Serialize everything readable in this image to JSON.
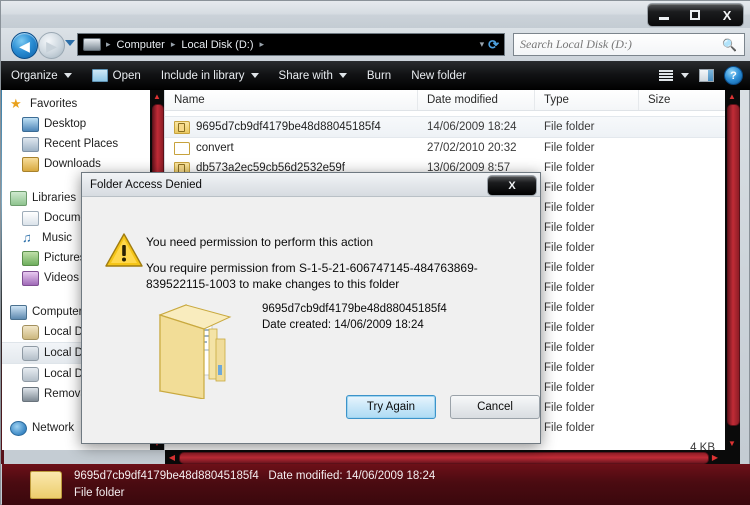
{
  "window": {
    "controls": {
      "minimize": "—",
      "maximize": "□",
      "close": "X"
    }
  },
  "address": {
    "back_glyph": "◀",
    "forward_glyph": "▶",
    "computer_icon": "drive-icon",
    "crumbs": [
      "Computer",
      "Local Disk (D:)"
    ],
    "separator": "▸",
    "dropdown_glyph": "▾",
    "refresh_glyph": "⟳"
  },
  "search": {
    "placeholder": "Search Local Disk (D:)",
    "value": "",
    "icon": "search-icon"
  },
  "toolbar": {
    "organize": "Organize",
    "open": "Open",
    "include_in_library": "Include in library",
    "share_with": "Share with",
    "burn": "Burn",
    "new_folder": "New folder",
    "view_icon": "list-view-icon",
    "view_caret": "▾",
    "preview_pane_icon": "preview-pane-icon",
    "help_icon": "help-icon",
    "help_glyph": "?"
  },
  "sidebar": {
    "groups": [
      {
        "header": "Favorites",
        "icon": "star-icon",
        "items": [
          {
            "label": "Desktop",
            "icon": "desktop-icon"
          },
          {
            "label": "Recent Places",
            "icon": "recent-places-icon"
          },
          {
            "label": "Downloads",
            "icon": "downloads-icon"
          }
        ]
      },
      {
        "header": "Libraries",
        "icon": "libraries-icon",
        "items": [
          {
            "label": "Documents",
            "icon": "documents-icon"
          },
          {
            "label": "Music",
            "icon": "music-icon"
          },
          {
            "label": "Pictures",
            "icon": "pictures-icon"
          },
          {
            "label": "Videos",
            "icon": "videos-icon"
          }
        ]
      },
      {
        "header": "Computer",
        "icon": "computer-icon",
        "items": [
          {
            "label": "Local Disk (C:)",
            "icon": "local-disk-c-icon"
          },
          {
            "label": "Local Disk (D:)",
            "icon": "local-disk-d-icon",
            "selected": true
          },
          {
            "label": "Local Disk (E:)",
            "icon": "local-disk-e-icon"
          },
          {
            "label": "Removable Disk (F:)",
            "icon": "removable-disk-icon"
          }
        ]
      },
      {
        "header": "Network",
        "icon": "network-icon",
        "items": []
      }
    ]
  },
  "filelist": {
    "columns": [
      "Name",
      "Date modified",
      "Type",
      "Size"
    ],
    "sort_column": "Name",
    "rows": [
      {
        "name": "9695d7cb9df4179be48d88045185f4",
        "date": "14/06/2009 18:24",
        "type": "File folder",
        "size": "",
        "icon": "locked-folder-icon",
        "selected": true
      },
      {
        "name": "convert",
        "date": "27/02/2010 20:32",
        "type": "File folder",
        "size": "",
        "icon": "folder-icon"
      },
      {
        "name": "db573a2ec59cb56d2532e59f",
        "date": "13/06/2009 8:57",
        "type": "File folder",
        "size": "",
        "icon": "locked-folder-icon"
      },
      {
        "name": "",
        "date": "",
        "type": "File folder",
        "size": "",
        "icon": "folder-icon"
      },
      {
        "name": "",
        "date": "",
        "type": "File folder",
        "size": "",
        "icon": "folder-icon"
      },
      {
        "name": "",
        "date": "",
        "type": "File folder",
        "size": "",
        "icon": "folder-icon"
      },
      {
        "name": "",
        "date": "",
        "type": "File folder",
        "size": "",
        "icon": "folder-icon"
      },
      {
        "name": "",
        "date": "",
        "type": "File folder",
        "size": "",
        "icon": "folder-icon"
      },
      {
        "name": "",
        "date": "",
        "type": "File folder",
        "size": "",
        "icon": "folder-icon"
      },
      {
        "name": "",
        "date": "",
        "type": "File folder",
        "size": "",
        "icon": "folder-icon"
      },
      {
        "name": "",
        "date": "",
        "type": "File folder",
        "size": "",
        "icon": "folder-icon"
      },
      {
        "name": "",
        "date": "",
        "type": "File folder",
        "size": "",
        "icon": "folder-icon"
      },
      {
        "name": "",
        "date": "",
        "type": "File folder",
        "size": "",
        "icon": "folder-icon"
      },
      {
        "name": "",
        "date": "",
        "type": "File folder",
        "size": "",
        "icon": "folder-icon"
      },
      {
        "name": "",
        "date": "",
        "type": "File folder",
        "size": "",
        "icon": "folder-icon"
      },
      {
        "name": "",
        "date": "",
        "type": "File folder",
        "size": "",
        "icon": "folder-icon"
      },
      {
        "name": "",
        "date": "",
        "type": "",
        "size": "4 KB",
        "icon": "folder-icon"
      }
    ]
  },
  "statusbar": {
    "name": "9695d7cb9df4179be48d88045185f4",
    "date_label": "Date modified: 14/06/2009 18:24",
    "type": "File folder",
    "icon": "folder-icon"
  },
  "dialog": {
    "title": "Folder Access Denied",
    "close_glyph": "X",
    "warning_icon": "warning-icon",
    "message_1": "You need permission to perform this action",
    "message_2": "You require permission from S-1-5-21-606747145-484763869-839522115-1003 to make changes to this folder",
    "folder_icon": "folder-stack-icon",
    "folder_name": "9695d7cb9df4179be48d88045185f4",
    "folder_date": "Date created: 14/06/2009 18:24",
    "try_again_label": "Try Again",
    "cancel_label": "Cancel"
  },
  "scrollbars": {
    "up_glyph": "▲",
    "down_glyph": "▼",
    "left_glyph": "◀",
    "right_glyph": "▶"
  },
  "colors": {
    "accent_red": "#c02b36",
    "status_bg": "#4b0b11",
    "toolbar_bg": "#121315",
    "dialog_bg": "#f0f0f0",
    "button_accent": "#3c93c9"
  }
}
